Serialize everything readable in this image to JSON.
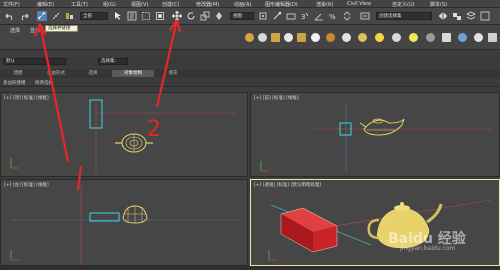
{
  "menu": [
    "文件(F)",
    "编辑(E)",
    "工具(T)",
    "组(G)",
    "视图(V)",
    "创建(C)",
    "修改器(M)",
    "动画(A)",
    "图形编辑器(D)",
    "渲染(R)",
    "Civil View",
    "自定义(U)",
    "脚本(S)"
  ],
  "toolbar": {
    "filter_dropdown": "全部",
    "view_dropdown": "视图",
    "selection_set_dropdown": "创建选择集"
  },
  "ribbon": {
    "tabs": [
      "选择",
      "显示"
    ],
    "tooltip": "选择并链接"
  },
  "layer": {
    "layer_name": "默认",
    "selection_filter": "选择集:"
  },
  "tabs": [
    "建模",
    "自由形式",
    "选择",
    "对象绘制",
    "填充"
  ],
  "subtabs": [
    "多边形建模",
    "修改选择"
  ],
  "viewports": [
    {
      "label": "[+] [顶] [标准] [线框]"
    },
    {
      "label": "[+] [前] [标准] [线框]"
    },
    {
      "label": "[+] [左] [标准] [线框]"
    },
    {
      "label": "[+] [透视] [标准] [默认明暗处理]"
    }
  ],
  "annotation": {
    "number": "2"
  },
  "watermark": {
    "brand": "Baidu 经验",
    "url": "jingyan.baidu.com"
  },
  "colors": {
    "annotation": "#e8262a",
    "selection_cyan": "#3fd8e0",
    "teapot": "#e8d26a",
    "box_red": "#c8242a"
  }
}
